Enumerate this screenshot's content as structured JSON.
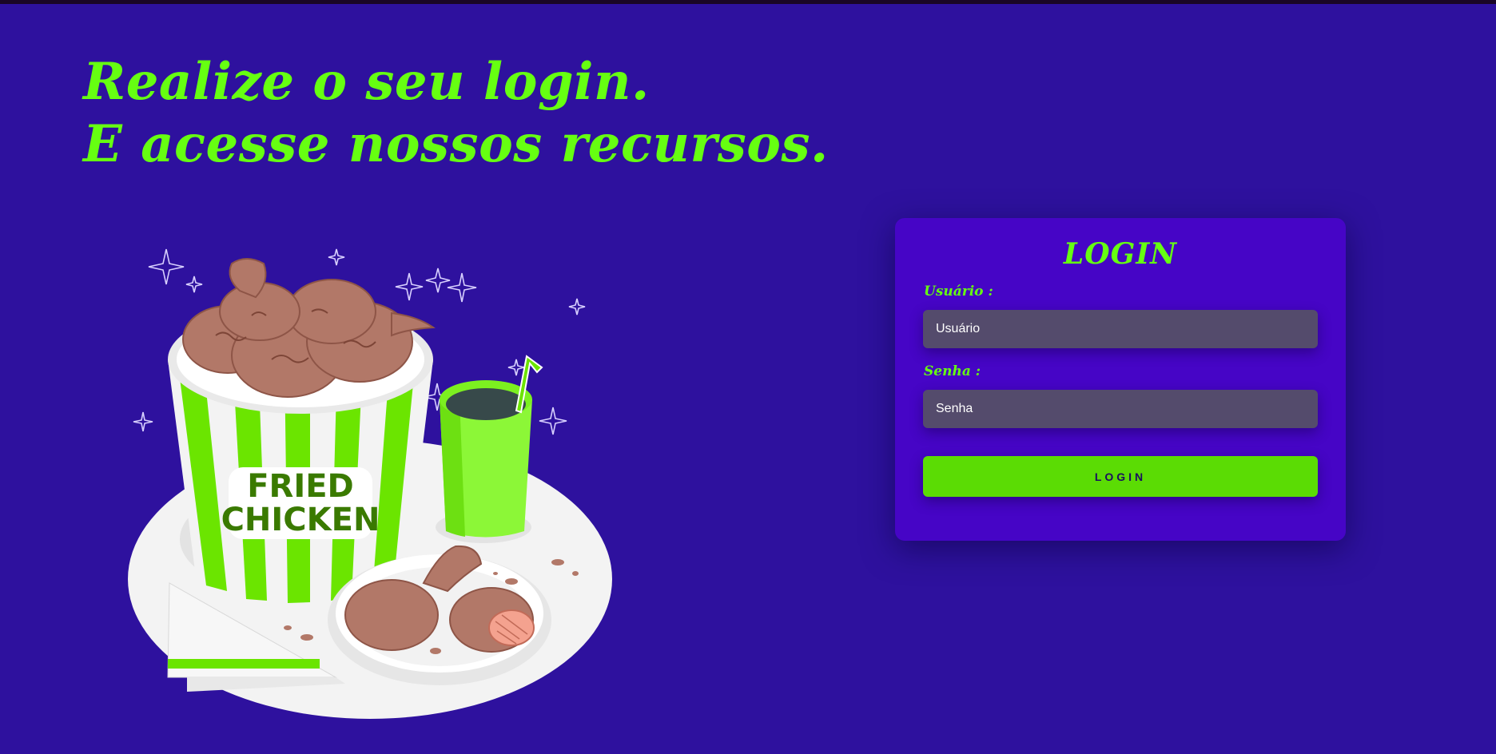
{
  "headline": {
    "line1": "Realize o seu login.",
    "line2": "E acesse nossos recursos."
  },
  "illustration": {
    "bucket_text_line1": "FRIED",
    "bucket_text_line2": "CHICKEN"
  },
  "login_card": {
    "title": "LOGIN",
    "username_label": "Usuário :",
    "username_placeholder": "Usuário",
    "password_label": "Senha :",
    "password_placeholder": "Senha",
    "submit_label": "LOGIN"
  },
  "colors": {
    "background": "#2e119e",
    "card": "#4605c6",
    "accent": "#66ff11",
    "button": "#5bdc04",
    "input": "#544b6c"
  }
}
